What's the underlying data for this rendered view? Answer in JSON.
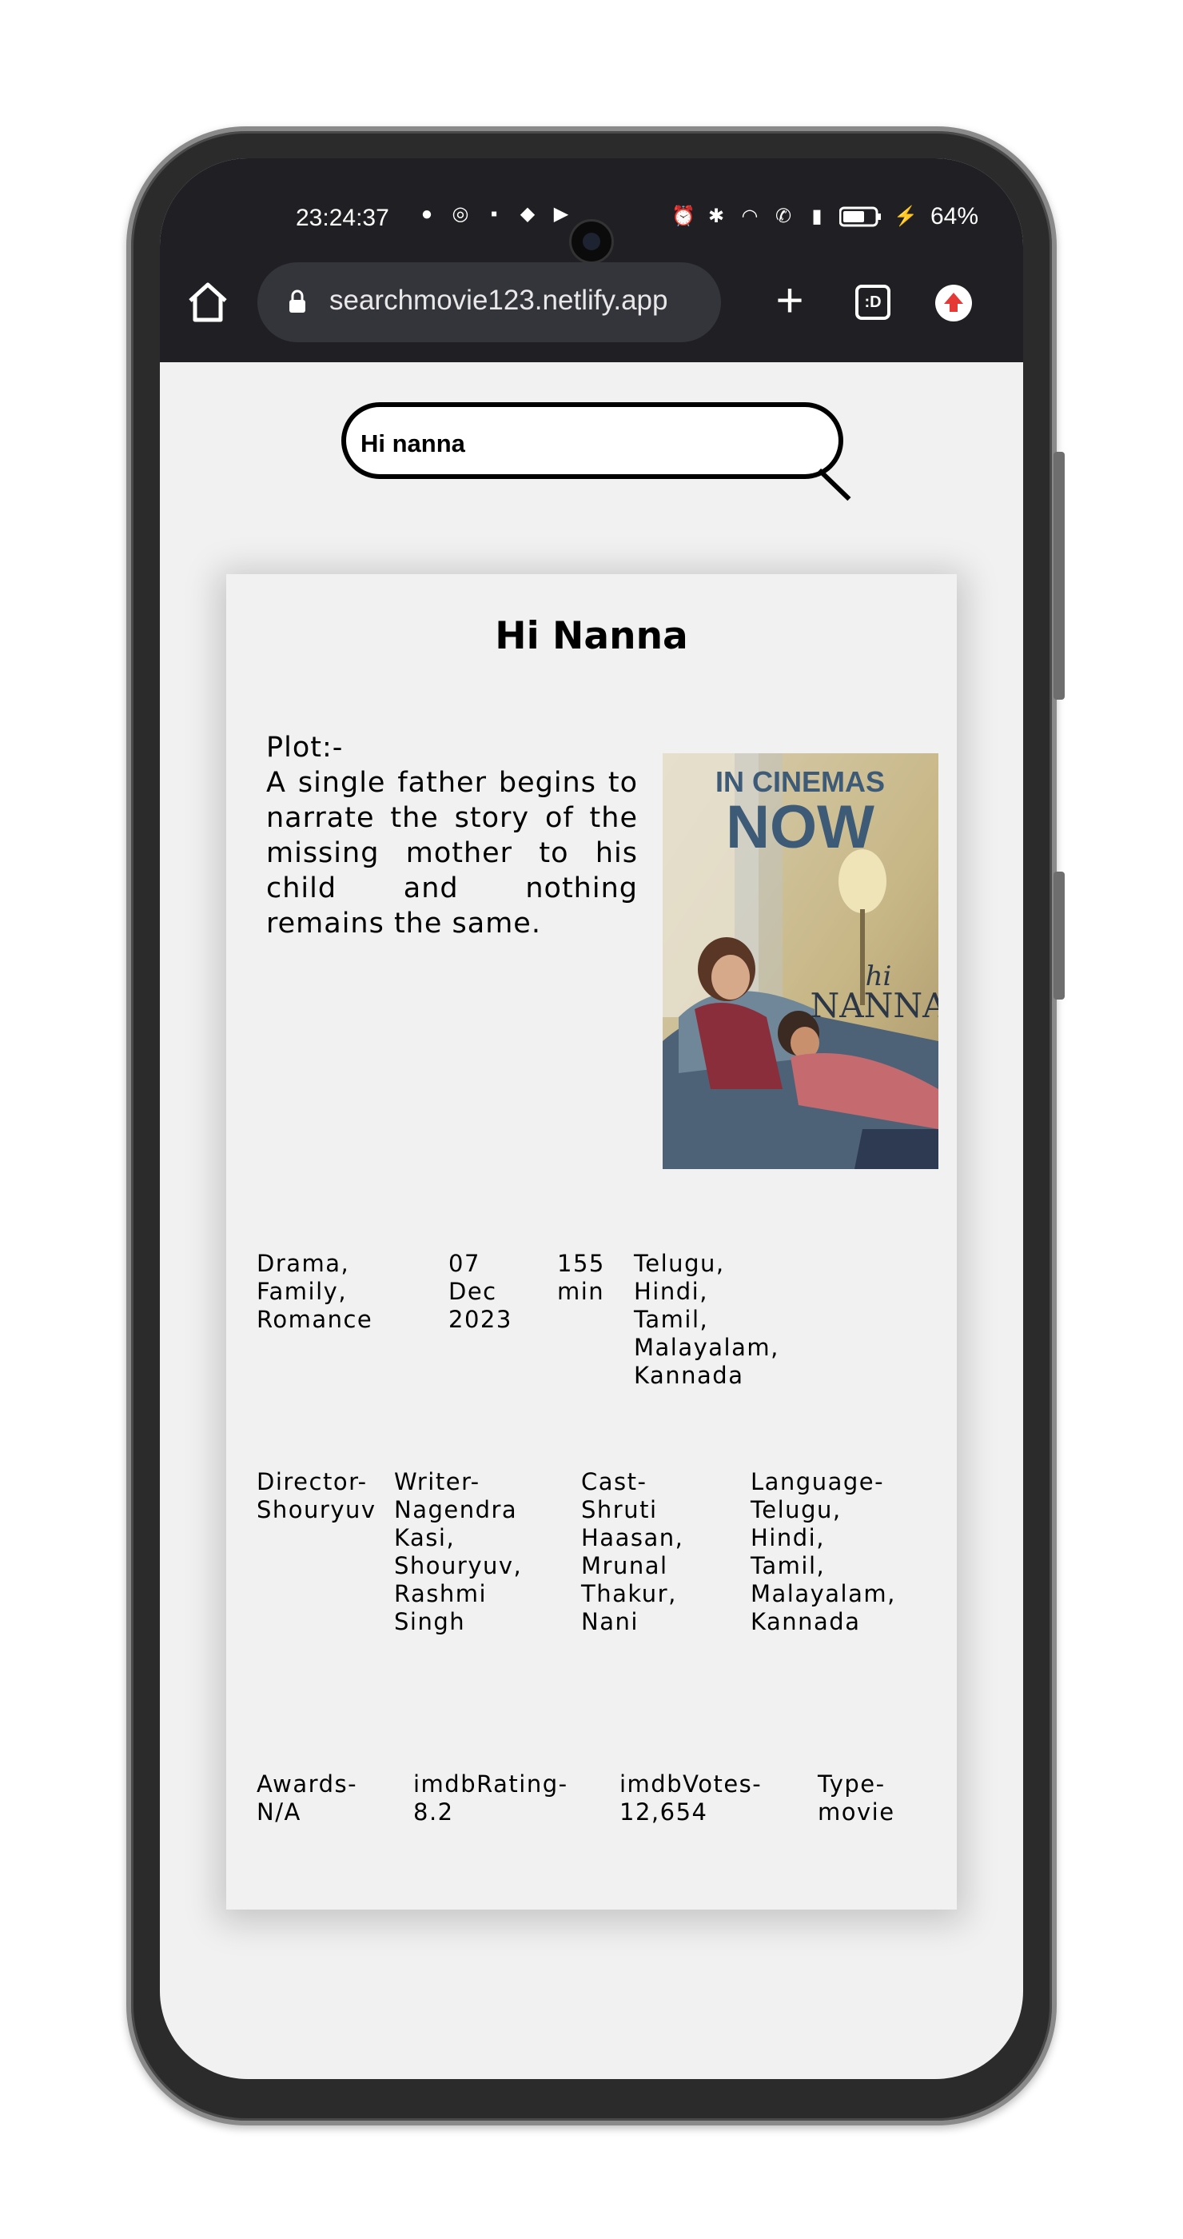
{
  "status_bar": {
    "time": "23:24:37",
    "battery": "64%"
  },
  "browser": {
    "url": "searchmovie123.netlify.app",
    "tabs_icon_text": ":D"
  },
  "search": {
    "value": "Hi nanna"
  },
  "movie": {
    "title": "Hi Nanna",
    "plot_label": "Plot:-",
    "plot": "A single father begins to narrate the story of the missing mother to his child and nothing remains the same.",
    "poster": {
      "banner_line1": "IN CINEMAS",
      "banner_line2": "NOW",
      "title_small": "hi",
      "title_big": "NANNA"
    },
    "genre": "Drama,\nFamily,\nRomance",
    "released": "07 Dec\n2023",
    "runtime": "155\nmin",
    "languages": "Telugu, Hindi, Tamil,\nMalayalam, Kannada",
    "director": "Director-\nShouryuv",
    "writer": "Writer-\nNagendra\nKasi,\nShouryuv,\nRashmi\nSingh",
    "cast": "Cast-\nShruti\nHaasan,\nMrunal\nThakur,\nNani",
    "language_detail": "Language-\nTelugu, Hindi,\nTamil,\nMalayalam,\nKannada",
    "awards": "Awards-\nN/A",
    "imdb_rating": "imdbRating-\n8.2",
    "imdb_votes": "imdbVotes-\n12,654",
    "type": "Type-\nmovie"
  }
}
